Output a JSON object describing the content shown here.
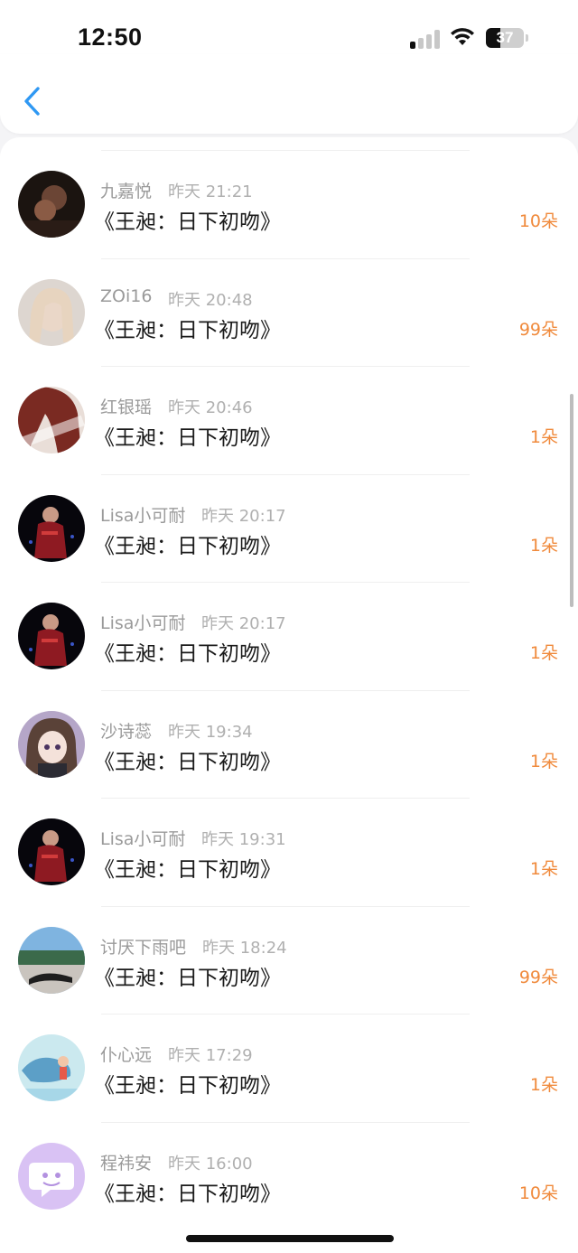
{
  "status_bar": {
    "time": "12:50",
    "battery_level": "37",
    "signal_bars_active": 1
  },
  "nav": {
    "back_icon": "chevron-left-icon",
    "accent_color": "#2f98f3"
  },
  "list": {
    "amount_color": "#f08a3c",
    "items": [
      {
        "name": "九嘉悦",
        "time": "昨天 21:21",
        "title": "《王昶：日下初吻》",
        "amount": "10朵",
        "avatar": "avatar-dark-photo"
      },
      {
        "name": "ZOi16",
        "time": "昨天 20:48",
        "title": "《王昶：日下初吻》",
        "amount": "99朵",
        "avatar": "avatar-blonde-girl"
      },
      {
        "name": "红银瑶",
        "time": "昨天 20:46",
        "title": "《王昶：日下初吻》",
        "amount": "1朵",
        "avatar": "avatar-red-hair"
      },
      {
        "name": "Lisa小可耐",
        "time": "昨天 20:17",
        "title": "《王昶：日下初吻》",
        "amount": "1朵",
        "avatar": "avatar-singer"
      },
      {
        "name": "Lisa小可耐",
        "time": "昨天 20:17",
        "title": "《王昶：日下初吻》",
        "amount": "1朵",
        "avatar": "avatar-singer"
      },
      {
        "name": "沙诗蕊",
        "time": "昨天 19:34",
        "title": "《王昶：日下初吻》",
        "amount": "1朵",
        "avatar": "avatar-anime-girl"
      },
      {
        "name": "Lisa小可耐",
        "time": "昨天 19:31",
        "title": "《王昶：日下初吻》",
        "amount": "1朵",
        "avatar": "avatar-singer"
      },
      {
        "name": "讨厌下雨吧",
        "time": "昨天 18:24",
        "title": "《王昶：日下初吻》",
        "amount": "99朵",
        "avatar": "avatar-landscape"
      },
      {
        "name": "仆心远",
        "time": "昨天 17:29",
        "title": "《王昶：日下初吻》",
        "amount": "1朵",
        "avatar": "avatar-whale"
      },
      {
        "name": "程祎安",
        "time": "昨天 16:00",
        "title": "《王昶：日下初吻》",
        "amount": "10朵",
        "avatar": "avatar-chat-bubble"
      }
    ]
  }
}
